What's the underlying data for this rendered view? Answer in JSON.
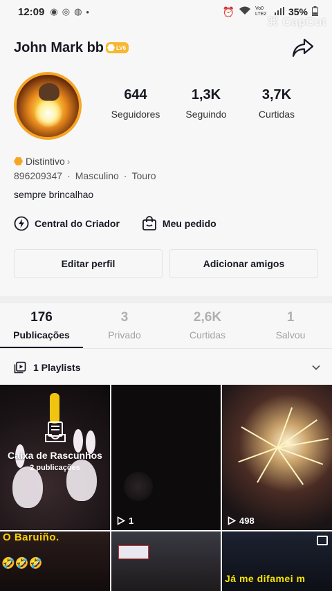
{
  "status_bar": {
    "time": "12:09",
    "battery": "35%",
    "network": "Vo0 LTE2",
    "watermark": "CapCut"
  },
  "profile": {
    "username": "John Mark bb",
    "level_badge": "LV6",
    "stats": [
      {
        "value": "644",
        "label": "Seguidores"
      },
      {
        "value": "1,3K",
        "label": "Seguindo"
      },
      {
        "value": "3,7K",
        "label": "Curtidas"
      }
    ],
    "badge_label": "Distintivo",
    "id": "896209347",
    "gender": "Masculino",
    "sign": "Touro",
    "bio": "sempre brincalhao",
    "creator_center": "Central do Criador",
    "my_order": "Meu pedido",
    "edit_profile": "Editar perfil",
    "add_friends": "Adicionar amigos"
  },
  "tabs": [
    {
      "count": "176",
      "label": "Publicações",
      "active": true
    },
    {
      "count": "3",
      "label": "Privado",
      "active": false
    },
    {
      "count": "2,6K",
      "label": "Curtidas",
      "active": false
    },
    {
      "count": "1",
      "label": "Salvou",
      "active": false
    }
  ],
  "playlists_label": "1 Playlists",
  "grid": {
    "draft_title": "Caixa de Rascunhos",
    "draft_sub": "2 publicações",
    "views": [
      "1",
      "498"
    ],
    "overlay_1": "O Baruiño.",
    "emojis_1": "🤣🤣🤣",
    "overlay_3": "Já me difamei m"
  },
  "colors": {
    "accent_gold": "#f5a623",
    "text_primary": "#161823",
    "inactive_tab": "#a2a2a6"
  },
  "icons": [
    "share-icon",
    "bolt-icon",
    "bag-icon",
    "playlist-icon",
    "chevron-down-icon",
    "play-icon",
    "draft-icon",
    "multi-image-icon"
  ]
}
